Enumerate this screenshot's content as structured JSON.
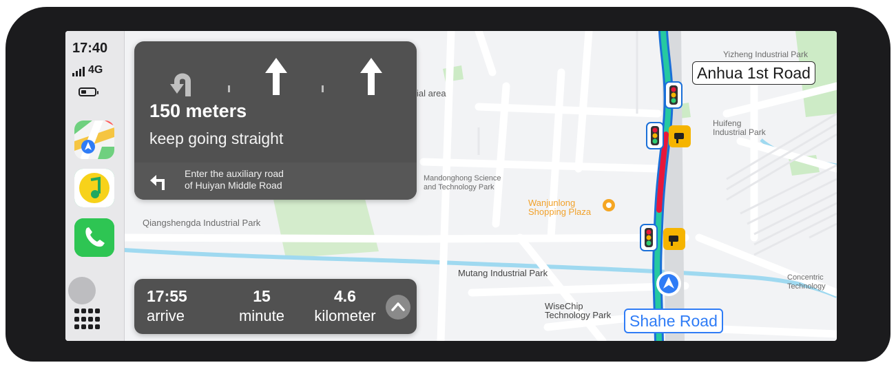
{
  "status_bar": {
    "time": "17:40",
    "network": "4G"
  },
  "dock": {
    "apps": [
      {
        "name": "Maps",
        "icon": "maps-icon"
      },
      {
        "name": "Music",
        "icon": "music-icon"
      },
      {
        "name": "Phone",
        "icon": "phone-icon"
      }
    ],
    "home_icon": "app-grid-icon"
  },
  "maneuver": {
    "distance": "150 meters",
    "instruction": "keep going straight",
    "lane_icons": [
      "u-turn-left-icon",
      "straight-arrow-icon",
      "straight-arrow-icon"
    ],
    "next_step": {
      "icon": "turn-left-icon",
      "line1": "Enter the auxiliary road",
      "line2": "of Huiyan Middle Road"
    }
  },
  "trip": {
    "arrival_time": "17:55",
    "arrival_label": "arrive",
    "duration": "15",
    "duration_label": "minute",
    "distance": "4.6",
    "distance_label": "kilometer",
    "expand_icon": "chevron-up-icon"
  },
  "map": {
    "road_signs": {
      "top": "Anhua 1st Road",
      "bottom": "Shahe Road"
    },
    "labels": {
      "yizheng": "Yizheng Industrial Park",
      "partial_area": "ial area",
      "huifeng_1": "Huifeng",
      "huifeng_2": "Industrial Park",
      "mandong_1": "Mandonghong Science",
      "mandong_2": "and Technology Park",
      "wanjun_1": "Wanjunlong",
      "wanjun_2": "Shopping Plaza",
      "qiang": "Qiangshengda Industrial Park",
      "mutang": "Mutang Industrial Park",
      "wisechip_1": "WiseChip",
      "wisechip_2": "Technology Park",
      "concentric_1": "Concentric",
      "concentric_2": "Technology"
    },
    "colors": {
      "route_free": "#26c9a0",
      "route_congested": "#e8173b",
      "route_outline": "#1a6fd8",
      "river": "#9fd9f0",
      "park": "#c9ebc3",
      "location": "#2f7cf6"
    }
  }
}
